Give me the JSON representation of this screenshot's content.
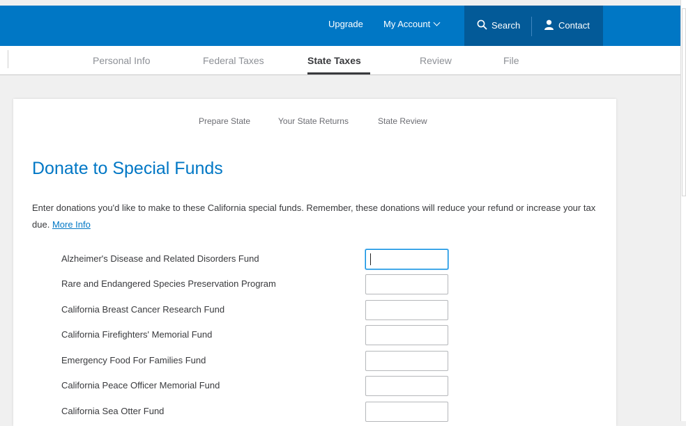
{
  "header": {
    "upgrade": "Upgrade",
    "my_account": "My Account",
    "search": "Search",
    "contact": "Contact",
    "accent_color": "#0077c5",
    "search_bg": "#035a98"
  },
  "tabs": [
    {
      "label": "Personal Info",
      "active": false
    },
    {
      "label": "Federal Taxes",
      "active": false
    },
    {
      "label": "State Taxes",
      "active": true
    },
    {
      "label": "Review",
      "active": false
    },
    {
      "label": "File",
      "active": false
    }
  ],
  "subnav": [
    "Prepare State",
    "Your State Returns",
    "State Review"
  ],
  "page": {
    "title": "Donate to Special Funds",
    "intro": "Enter donations you'd like to make to these California special funds. Remember, these donations will reduce your refund or increase your tax due.",
    "more_info": "More Info"
  },
  "funds": [
    {
      "label": "Alzheimer's Disease and Related Disorders Fund",
      "value": "",
      "focused": true
    },
    {
      "label": "Rare and Endangered Species Preservation Program",
      "value": ""
    },
    {
      "label": "California Breast Cancer Research Fund",
      "value": ""
    },
    {
      "label": "California Firefighters' Memorial Fund",
      "value": ""
    },
    {
      "label": "Emergency Food For Families Fund",
      "value": ""
    },
    {
      "label": "California Peace Officer Memorial Fund",
      "value": ""
    },
    {
      "label": "California Sea Otter Fund",
      "value": ""
    }
  ]
}
